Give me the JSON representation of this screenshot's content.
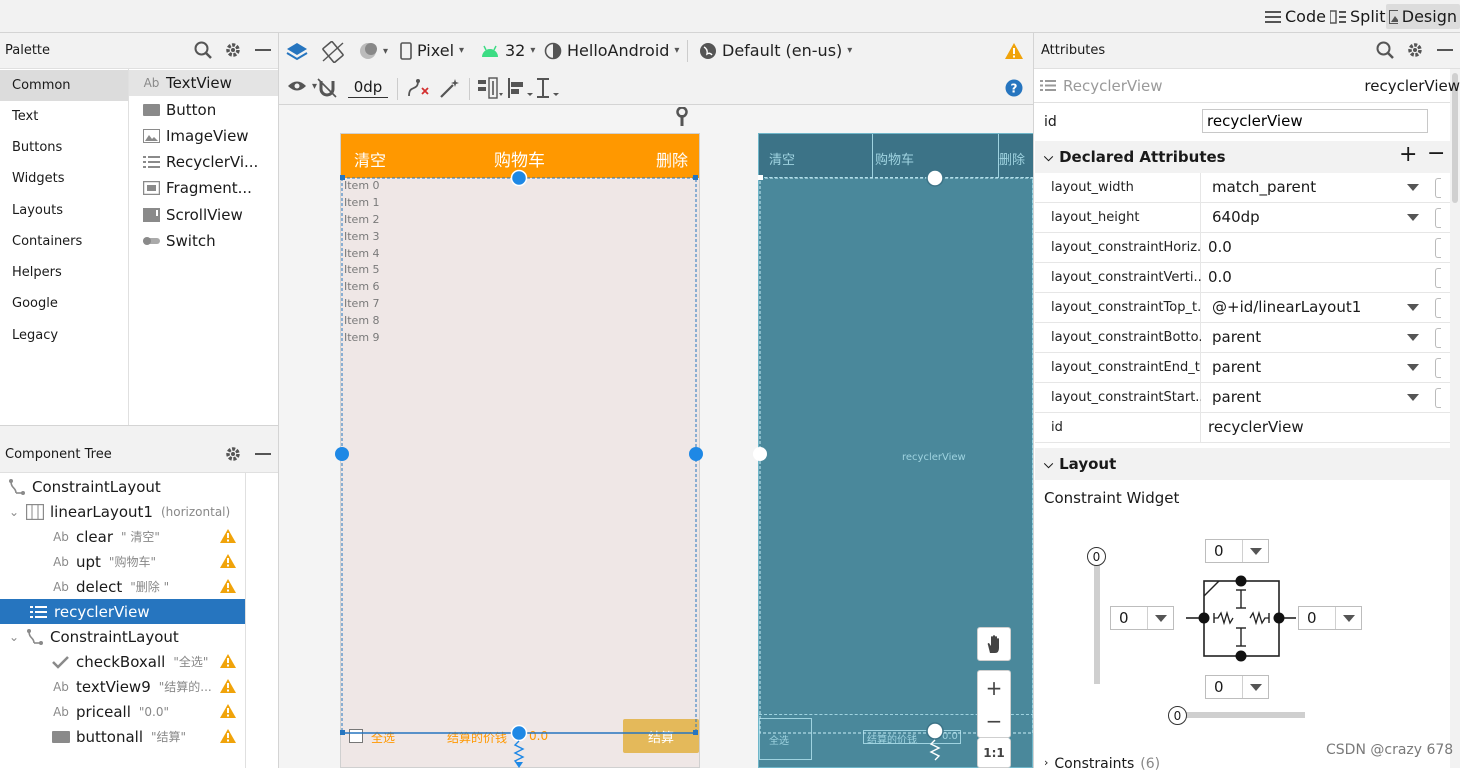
{
  "view_modes": [
    {
      "label": "Code"
    },
    {
      "label": "Split"
    },
    {
      "label": "Design"
    }
  ],
  "palette": {
    "title": "Palette",
    "categories": [
      "Common",
      "Text",
      "Buttons",
      "Widgets",
      "Layouts",
      "Containers",
      "Helpers",
      "Google",
      "Legacy"
    ],
    "selected_category": "Common",
    "widgets": [
      {
        "label": "TextView",
        "icon": "Ab"
      },
      {
        "label": "Button",
        "icon": "button-icon"
      },
      {
        "label": "ImageView",
        "icon": "image-icon"
      },
      {
        "label": "RecyclerVi...",
        "icon": "list-icon"
      },
      {
        "label": "Fragment...",
        "icon": "fragment-icon"
      },
      {
        "label": "ScrollView",
        "icon": "scroll-icon"
      },
      {
        "label": "Switch",
        "icon": "switch-icon"
      }
    ]
  },
  "component_tree": {
    "title": "Component Tree",
    "nodes": [
      {
        "label": "ConstraintLayout",
        "sub": "",
        "icon": "constraint-icon",
        "warn": false
      },
      {
        "label": "linearLayout1",
        "sub": "(horizontal)",
        "icon": "linear-icon",
        "warn": false
      },
      {
        "label": "clear",
        "sub": "\"  清空\"",
        "icon": "Ab",
        "warn": true
      },
      {
        "label": "upt",
        "sub": "\"购物车\"",
        "icon": "Ab",
        "warn": true
      },
      {
        "label": "delect",
        "sub": "\"删除   \"",
        "icon": "Ab",
        "warn": true
      },
      {
        "label": "recyclerView",
        "sub": "",
        "icon": "list-icon",
        "warn": false
      },
      {
        "label": "ConstraintLayout",
        "sub": "",
        "icon": "constraint-icon",
        "warn": false
      },
      {
        "label": "checkBoxall",
        "sub": "\"全选\"",
        "icon": "check-icon",
        "warn": true
      },
      {
        "label": "textView9",
        "sub": "\"结算的...",
        "icon": "Ab",
        "warn": true
      },
      {
        "label": "priceall",
        "sub": "\"0.0\"",
        "icon": "Ab",
        "warn": true
      },
      {
        "label": "buttonall",
        "sub": "\"结算\"",
        "icon": "button-icon",
        "warn": true
      }
    ]
  },
  "toolbar": {
    "device": "Pixel",
    "api": "32",
    "theme": "HelloAndroid",
    "locale": "Default (en-us)",
    "margin": "0dp"
  },
  "phone": {
    "clear": "清空",
    "title": "购物车",
    "delete": "删除",
    "items": [
      "Item 0",
      "Item 1",
      "Item 2",
      "Item 3",
      "Item 4",
      "Item 5",
      "Item 6",
      "Item 7",
      "Item 8",
      "Item 9"
    ],
    "select_all": "全选",
    "settle_label": "结算的价钱",
    "price": "0.0",
    "settle_button": "结算"
  },
  "blueprint": {
    "clear": "清空",
    "title": "购物车",
    "delete": "删除",
    "recycler_label": "recyclerView",
    "select_all": "全选",
    "settle_label": "结算的价钱",
    "price": "0.0"
  },
  "zoom": {
    "plus": "+",
    "minus": "−",
    "ratio": "1:1"
  },
  "attributes": {
    "title": "Attributes",
    "component_type": "RecyclerView",
    "component_id": "recyclerView",
    "id_label": "id",
    "id_value": "recyclerView",
    "declared_title": "Declared Attributes",
    "rows": [
      {
        "name": "layout_width",
        "value": "match_parent",
        "dropdown": true
      },
      {
        "name": "layout_height",
        "value": "640dp",
        "dropdown": true
      },
      {
        "name": "layout_constraintHoriz...",
        "value": "0.0",
        "dropdown": false
      },
      {
        "name": "layout_constraintVerti...",
        "value": "0.0",
        "dropdown": false
      },
      {
        "name": "layout_constraintTop_t...",
        "value": "@+id/linearLayout1",
        "dropdown": true
      },
      {
        "name": "layout_constraintBotto...",
        "value": "parent",
        "dropdown": true
      },
      {
        "name": "layout_constraintEnd_t...",
        "value": "parent",
        "dropdown": true
      },
      {
        "name": "layout_constraintStart...",
        "value": "parent",
        "dropdown": true
      },
      {
        "name": "id",
        "value": "recyclerView",
        "dropdown": false
      }
    ],
    "layout_title": "Layout",
    "constraint_widget": "Constraint Widget",
    "margins": {
      "top": "0",
      "left": "0",
      "right": "0",
      "bottom": "0"
    },
    "bias_vertical": "0",
    "bias_horizontal": "0",
    "constraints_title": "Constraints",
    "constraints_count": "(6)"
  },
  "watermark": "CSDN @crazy 678",
  "colors": {
    "accent": "#ff9800",
    "selection": "#2675bf",
    "blueprint": "#4a889b",
    "warning": "#f0a30a"
  }
}
